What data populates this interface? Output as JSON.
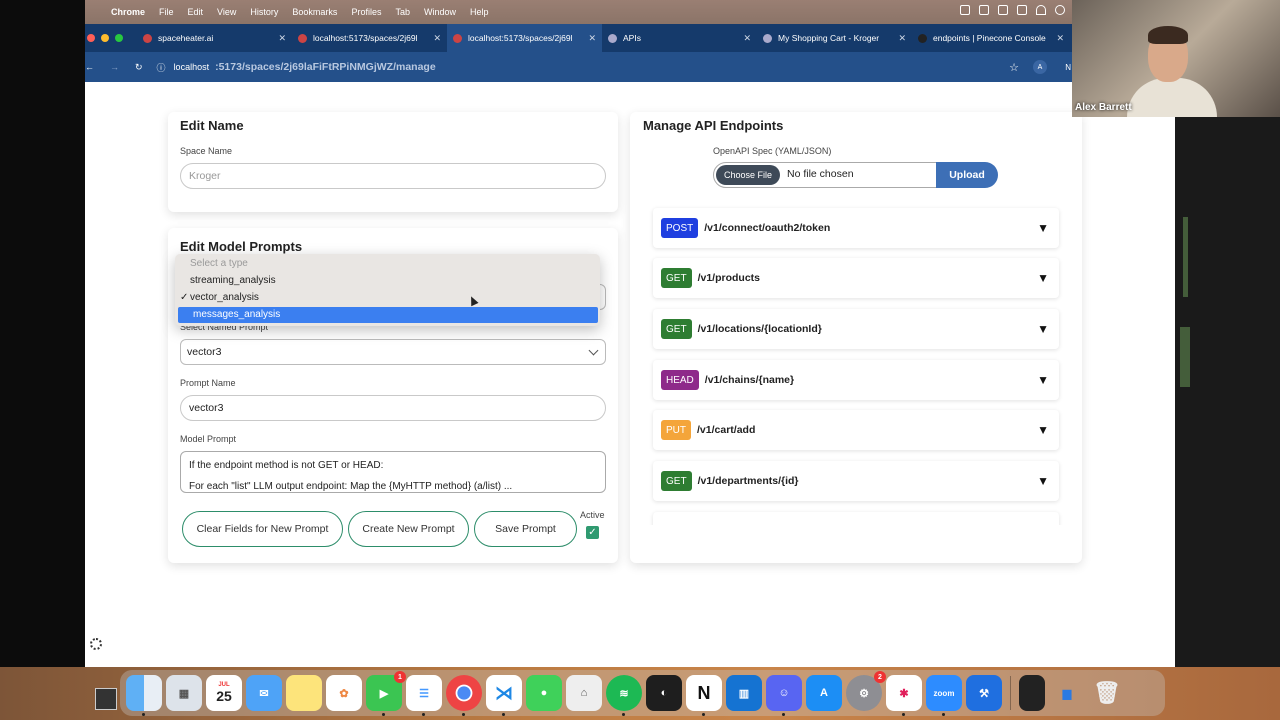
{
  "menubar": {
    "app": "Chrome",
    "items": [
      "File",
      "Edit",
      "View",
      "History",
      "Bookmarks",
      "Profiles",
      "Tab",
      "Window",
      "Help"
    ]
  },
  "tabs": [
    {
      "label": "spaceheater.ai"
    },
    {
      "label": "localhost:5173/spaces/2j69l"
    },
    {
      "label": "localhost:5173/spaces/2j69l"
    },
    {
      "label": "APIs"
    },
    {
      "label": "My Shopping Cart - Kroger"
    },
    {
      "label": "endpoints | Pinecone Console"
    }
  ],
  "address": {
    "host": "localhost",
    "path": ":5173/spaces/2j69laFiFtRPiNMGjWZ/manage",
    "profile": "A",
    "profile2": "N"
  },
  "edit_name": {
    "title": "Edit Name",
    "space_name_label": "Space Name",
    "space_name_placeholder": "Kroger"
  },
  "edit_prompts": {
    "title": "Edit Model Prompts",
    "select_type_options": [
      {
        "label": "Select a type",
        "disabled": true
      },
      {
        "label": "streaming_analysis"
      },
      {
        "label": "vector_analysis",
        "checked": true
      },
      {
        "label": "messages_analysis",
        "highlighted": true
      }
    ],
    "select_named_label": "Select Named Prompt",
    "select_named_value": "vector3",
    "prompt_name_label": "Prompt Name",
    "prompt_name_value": "vector3",
    "model_prompt_label": "Model Prompt",
    "model_prompt_line1": "If the endpoint method is not GET or HEAD:",
    "model_prompt_line2": "For each \"list\" LLM output endpoint: Map the {MyHTTP method} (a/list) ...",
    "buttons": {
      "clear": "Clear Fields for New Prompt",
      "create": "Create New Prompt",
      "save": "Save Prompt"
    },
    "active_label": "Active",
    "active_checked": true
  },
  "manage_api": {
    "title": "Manage API Endpoints",
    "spec_label": "OpenAPI Spec (YAML/JSON)",
    "choose_file": "Choose File",
    "no_file": "No file chosen",
    "upload": "Upload",
    "endpoints": [
      {
        "method": "POST",
        "path": "/v1/connect/oauth2/token",
        "color": "#1f3fe0"
      },
      {
        "method": "GET",
        "path": "/v1/products",
        "color": "#2e7d32"
      },
      {
        "method": "GET",
        "path": "/v1/locations/{locationId}",
        "color": "#2e7d32"
      },
      {
        "method": "HEAD",
        "path": "/v1/chains/{name}",
        "color": "#8e2a8a"
      },
      {
        "method": "PUT",
        "path": "/v1/cart/add",
        "color": "#f4a53a"
      },
      {
        "method": "GET",
        "path": "/v1/departments/{id}",
        "color": "#2e7d32"
      }
    ],
    "expand_glyph": "▼"
  },
  "video": {
    "name": "Alex Barrett"
  },
  "dock": {
    "calendar_month": "JUL",
    "calendar_day": "25",
    "apps": [
      "Finder",
      "Launchpad",
      "Calendar",
      "Mail",
      "Notes",
      "Photos",
      "FaceTime",
      "Reminders",
      "Chrome",
      "VS Code",
      "Messages",
      "Preview",
      "Spotify",
      "Figma",
      "Notion",
      "Trello",
      "Discord",
      "App Store",
      "System Settings",
      "Slack",
      "Zoom",
      "Xcode"
    ],
    "badges": {
      "facetime": "1",
      "settings": "2"
    }
  }
}
